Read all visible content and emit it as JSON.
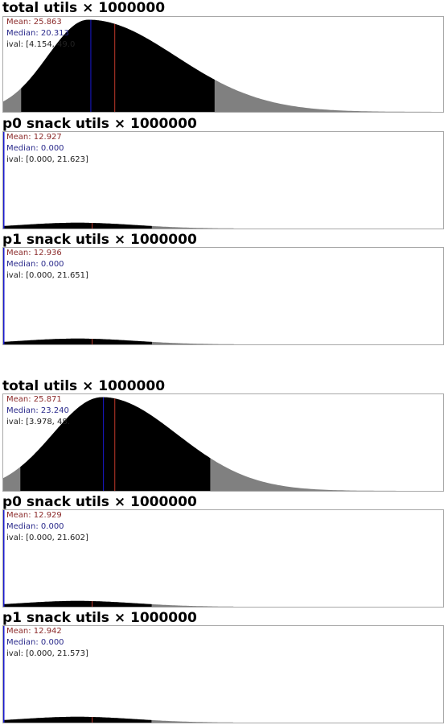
{
  "colors": {
    "core": "#000000",
    "tail": "#808080",
    "mean": "#c0392b",
    "median": "#1a1ad0"
  },
  "chart_data": [
    {
      "type": "histogram",
      "title": "total utils × 1000000",
      "shape": "bell",
      "mean_label": "Mean: 25.863",
      "median_label": "Median: 20.313",
      "ival_label": "ival: [4.154, 49.0",
      "mean": 25.863,
      "median": 20.313,
      "ival": [
        4.154,
        49.0
      ],
      "xlim": [
        0,
        102
      ]
    },
    {
      "type": "histogram",
      "title": "p0 snack utils × 1000000",
      "shape": "spike",
      "mean_label": "Mean: 12.927",
      "median_label": "Median: 0.000",
      "ival_label": "ival: [0.000, 21.623]",
      "mean": 12.927,
      "median": 0.0,
      "ival": [
        0.0,
        21.623
      ],
      "xlim": [
        0,
        64
      ]
    },
    {
      "type": "histogram",
      "title": "p1 snack utils × 1000000",
      "shape": "spike",
      "mean_label": "Mean: 12.936",
      "median_label": "Median: 0.000",
      "ival_label": "ival: [0.000, 21.651]",
      "mean": 12.936,
      "median": 0.0,
      "ival": [
        0.0,
        21.651
      ],
      "xlim": [
        0,
        64
      ]
    },
    {
      "type": "histogram",
      "title": "total utils × 1000000",
      "shape": "bell",
      "mean_label": "Mean: 25.871",
      "median_label": "Median: 23.240",
      "ival_label": "ival: [3.978, 48.",
      "mean": 25.871,
      "median": 23.24,
      "ival": [
        3.978,
        48.0
      ],
      "xlim": [
        0,
        102
      ]
    },
    {
      "type": "histogram",
      "title": "p0 snack utils × 1000000",
      "shape": "spike",
      "mean_label": "Mean: 12.929",
      "median_label": "Median: 0.000",
      "ival_label": "ival: [0.000, 21.602]",
      "mean": 12.929,
      "median": 0.0,
      "ival": [
        0.0,
        21.602
      ],
      "xlim": [
        0,
        64
      ]
    },
    {
      "type": "histogram",
      "title": "p1 snack utils × 1000000",
      "shape": "spike",
      "mean_label": "Mean: 12.942",
      "median_label": "Median: 0.000",
      "ival_label": "ival: [0.000, 21.573]",
      "mean": 12.942,
      "median": 0.0,
      "ival": [
        0.0,
        21.573
      ],
      "xlim": [
        0,
        64
      ]
    }
  ]
}
